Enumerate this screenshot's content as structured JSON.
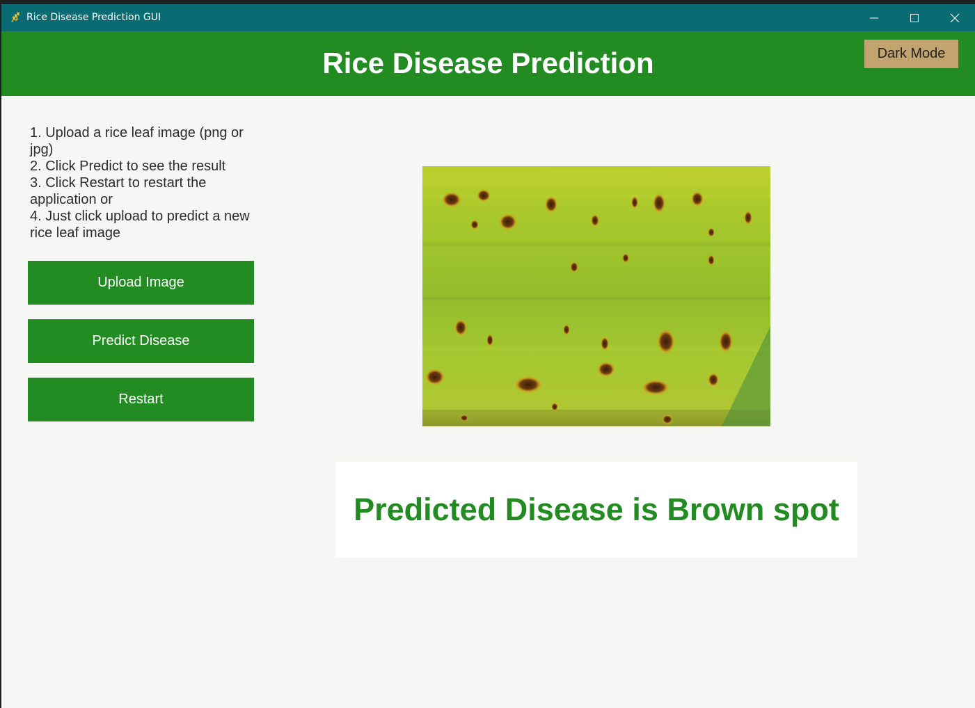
{
  "window": {
    "title": "Rice Disease Prediction GUI",
    "icon": "rice-icon",
    "controls": [
      "minimize-icon",
      "maximize-icon",
      "close-icon"
    ]
  },
  "header": {
    "title": "Rice Disease Prediction",
    "dark_mode_label": "Dark Mode"
  },
  "instructions": [
    "1. Upload a rice leaf image (png or jpg)",
    "2. Click Predict to see the result",
    "3. Click Restart to restart the application or",
    "4. Just click upload to predict a new rice leaf image"
  ],
  "buttons": {
    "upload": "Upload Image",
    "predict": "Predict Disease",
    "restart": "Restart"
  },
  "result": {
    "text": "Predicted Disease is Brown spot"
  },
  "colors": {
    "titlebar": "#0b6b72",
    "header": "#228b22",
    "primary": "#228b22",
    "dark_mode_button": "#c3a46e",
    "background": "#f6f6f4"
  }
}
